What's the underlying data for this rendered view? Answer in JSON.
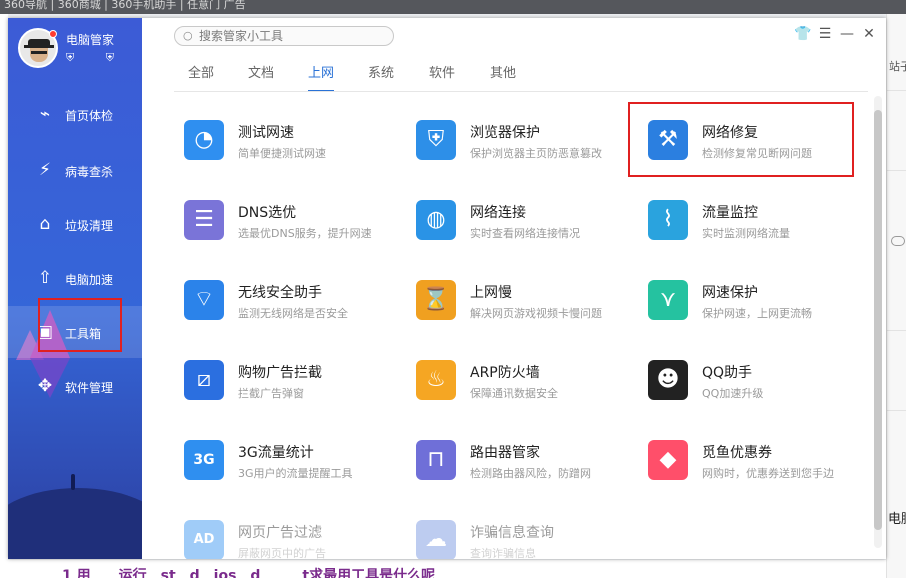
{
  "background": {
    "topbar_text": "360导航 | 360商城 | 360手机助手 | 任意门 广告",
    "right_text_1": "站子",
    "right_text_2": "电脑",
    "bottom_text": "1 用　　运行　st　d　ios　d　　　t求最用工具是什么呢"
  },
  "app": {
    "name": "电脑管家",
    "mini_icons": "⛨ ⛨"
  },
  "sidebar": {
    "items": [
      {
        "label": "首页体检",
        "icon": "monitor-icon",
        "glyph": "⌁"
      },
      {
        "label": "病毒查杀",
        "icon": "bolt-icon",
        "glyph": "⚡"
      },
      {
        "label": "垃圾清理",
        "icon": "broom-icon",
        "glyph": "⌂"
      },
      {
        "label": "电脑加速",
        "icon": "rocket-icon",
        "glyph": "⇧"
      },
      {
        "label": "工具箱",
        "icon": "toolbox-icon",
        "glyph": "▣"
      },
      {
        "label": "软件管理",
        "icon": "apps-icon",
        "glyph": "✥"
      }
    ],
    "active_index": 4
  },
  "search": {
    "placeholder": "搜索管家小工具"
  },
  "window_controls": {
    "skin": "👕",
    "menu": "☰",
    "minimize": "—",
    "close": "✕"
  },
  "tabs": [
    {
      "label": "全部"
    },
    {
      "label": "文档"
    },
    {
      "label": "上网"
    },
    {
      "label": "系统"
    },
    {
      "label": "软件"
    },
    {
      "label": "其他"
    }
  ],
  "active_tab": "上网",
  "tools": [
    {
      "name": "测试网速",
      "desc": "简单便捷测试网速",
      "icon": "speedometer-icon",
      "glyph": "◔",
      "color": "#2f8ff0"
    },
    {
      "name": "浏览器保护",
      "desc": "保护浏览器主页防恶意篡改",
      "icon": "browser-shield-icon",
      "glyph": "⛨",
      "color": "#2d8fe8"
    },
    {
      "name": "网络修复",
      "desc": "检测修复常见断网问题",
      "icon": "repair-hammer-icon",
      "glyph": "⚒",
      "color": "#2b7fe0"
    },
    {
      "name": "DNS选优",
      "desc": "选最优DNS服务，提升网速",
      "icon": "dns-server-icon",
      "glyph": "☰",
      "color": "#7a74d8"
    },
    {
      "name": "网络连接",
      "desc": "实时查看网络连接情况",
      "icon": "globe-icon",
      "glyph": "◍",
      "color": "#2a93e6"
    },
    {
      "name": "流量监控",
      "desc": "实时监测网络流量",
      "icon": "traffic-monitor-icon",
      "glyph": "⌇",
      "color": "#2aa3de"
    },
    {
      "name": "无线安全助手",
      "desc": "监测无线网络是否安全",
      "icon": "wifi-shield-icon",
      "glyph": "⌔",
      "color": "#2b83ea"
    },
    {
      "name": "上网慢",
      "desc": "解决网页游戏视频卡慢问题",
      "icon": "hourglass-icon",
      "glyph": "⌛",
      "color": "#f0a020"
    },
    {
      "name": "网速保护",
      "desc": "保护网速，上网更流畅",
      "icon": "speed-shield-icon",
      "glyph": "⋎",
      "color": "#25c2a0"
    },
    {
      "name": "购物广告拦截",
      "desc": "拦截广告弹窗",
      "icon": "ad-block-icon",
      "glyph": "⧄",
      "color": "#2b6fe0"
    },
    {
      "name": "ARP防火墙",
      "desc": "保障通讯数据安全",
      "icon": "firewall-icon",
      "glyph": "♨",
      "color": "#f5a623"
    },
    {
      "name": "QQ助手",
      "desc": "QQ加速升级",
      "icon": "qq-penguin-icon",
      "glyph": "☻",
      "color": "#222222"
    },
    {
      "name": "3G流量统计",
      "desc": "3G用户的流量提醒工具",
      "icon": "3g-icon",
      "glyph": "3G",
      "color": "#2f8ff0"
    },
    {
      "name": "路由器管家",
      "desc": "检测路由器风险，防蹭网",
      "icon": "router-icon",
      "glyph": "⊓",
      "color": "#6f6fd8"
    },
    {
      "name": "觅鱼优惠券",
      "desc": "网购时，优惠券送到您手边",
      "icon": "coupon-tag-icon",
      "glyph": "◆",
      "color": "#ff4f6a"
    },
    {
      "name": "网页广告过滤",
      "desc": "屏蔽网页中的广告",
      "icon": "ad-filter-icon",
      "glyph": "AD",
      "color": "#2f8ff0"
    },
    {
      "name": "诈骗信息查询",
      "desc": "查询诈骗信息",
      "icon": "fraud-query-icon",
      "glyph": "☁",
      "color": "#6f8fe0"
    }
  ]
}
